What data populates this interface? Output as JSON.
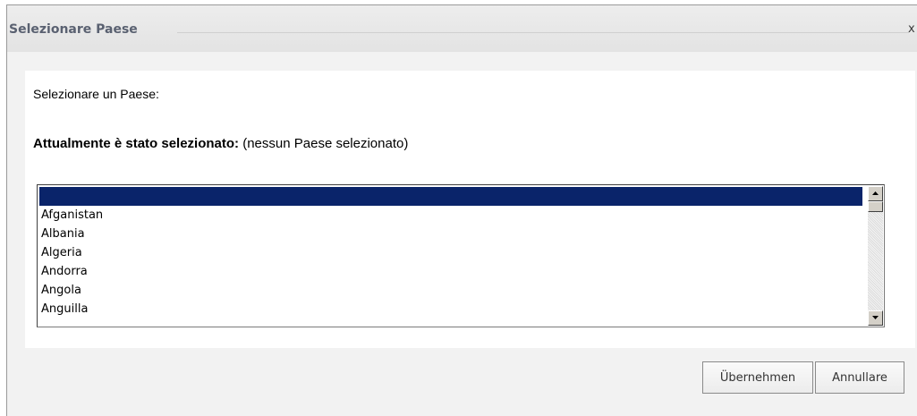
{
  "dialog": {
    "title": "Selezionare Paese",
    "close_label": "x"
  },
  "content": {
    "prompt": "Selezionare un Paese:",
    "current_label": "Attualmente è stato selezionato:",
    "current_value": "(nessun Paese selezionato)"
  },
  "country_list": {
    "selected_index": 0,
    "items": [
      "",
      "Afganistan",
      "Albania",
      "Algeria",
      "Andorra",
      "Angola",
      "Anguilla"
    ]
  },
  "buttons": {
    "apply_label": "Übernehmen",
    "cancel_label": "Annullare"
  },
  "colors": {
    "selection_background": "#0a246a",
    "title_text": "#5a6171"
  },
  "icons": {
    "scroll_up": "arrow-up-icon",
    "scroll_down": "arrow-down-icon"
  }
}
